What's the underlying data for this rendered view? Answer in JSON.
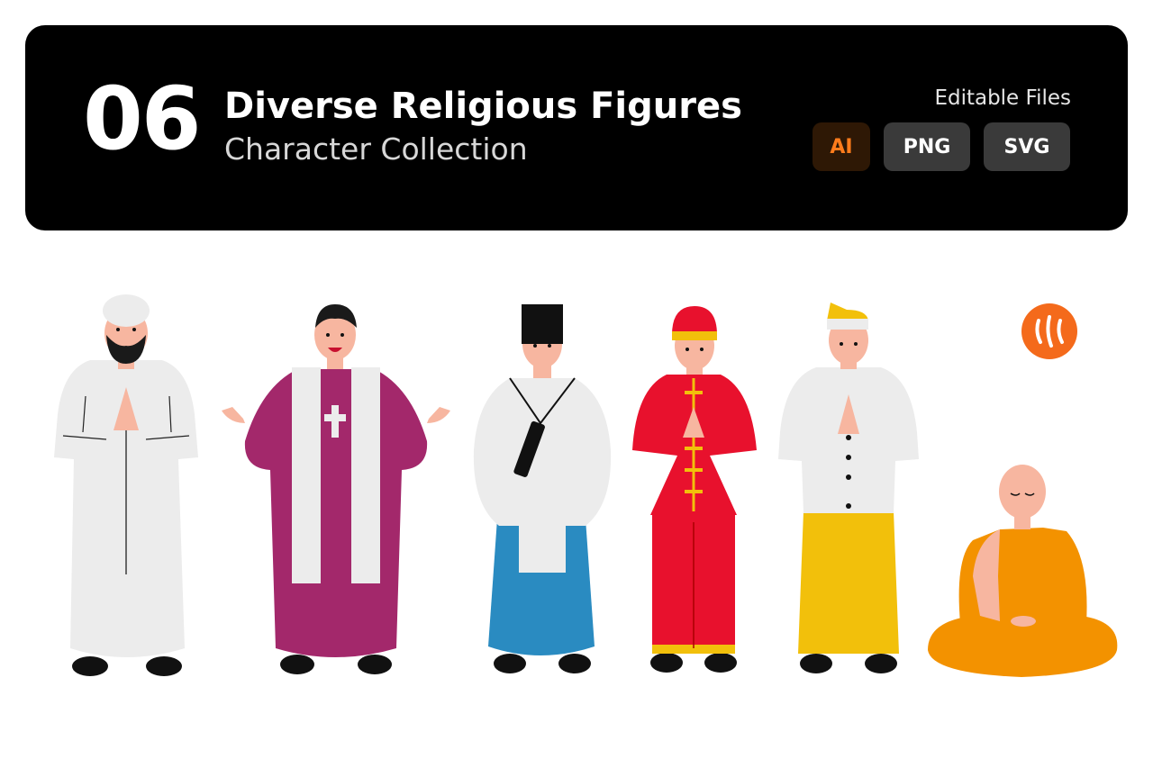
{
  "header": {
    "count": "06",
    "title": "Diverse Religious Figures",
    "subtitle": "Character Collection",
    "files_label": "Editable Files",
    "formats": [
      "AI",
      "PNG",
      "SVG"
    ]
  },
  "colors": {
    "banner_bg": "#000000",
    "ai_accent": "#ff7c1c",
    "brand_orange": "#f46a1b",
    "purple_robe": "#a3286b",
    "red_robe": "#e8112d",
    "yellow_sarong": "#f2c00b",
    "blue_hakama": "#2a8bc1",
    "monk_robe": "#f39200"
  },
  "figures": [
    {
      "icon": "muslim-cleric-figure"
    },
    {
      "icon": "christian-priest-figure"
    },
    {
      "icon": "shinto-priest-figure"
    },
    {
      "icon": "chinese-taoist-figure"
    },
    {
      "icon": "balinese-hindu-figure"
    },
    {
      "icon": "buddhist-monk-figure"
    }
  ],
  "brand": {
    "icon": "brand-logo-icon"
  }
}
